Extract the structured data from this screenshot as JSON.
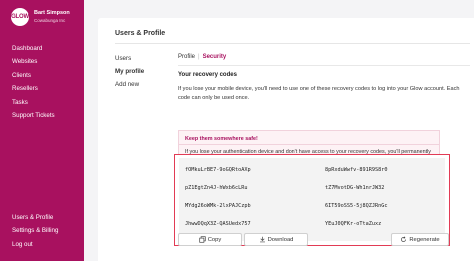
{
  "sidebar": {
    "logo_text": "GLOW",
    "user_name": "Bart Simpson",
    "user_subtitle": "Cowabunga Inc",
    "nav_items": [
      {
        "label": "Dashboard"
      },
      {
        "label": "Websites"
      },
      {
        "label": "Clients"
      },
      {
        "label": "Resellers"
      },
      {
        "label": "Tasks"
      },
      {
        "label": "Support Tickets"
      }
    ],
    "bottom_items": [
      {
        "label": "Users & Profile"
      },
      {
        "label": "Settings & Billing"
      },
      {
        "label": "Log out"
      }
    ]
  },
  "main": {
    "title": "Users & Profile",
    "submenu": [
      {
        "label": "Users"
      },
      {
        "label": "My profile"
      },
      {
        "label": "Add new"
      }
    ],
    "tabs": [
      {
        "label": "Profile"
      },
      {
        "label": "Security"
      }
    ],
    "tab_separator": "|",
    "section_heading": "Your recovery codes",
    "intro_text": "If you lose your mobile device, you'll need to use one of these recovery codes to log into your Glow account. Each code can only be used once.",
    "warning": {
      "heading": "Keep them somewhere safe!",
      "text": "If you lose your authentication device and don't have access to your recovery codes, you'll permanently lose access to your Glow account!"
    },
    "codes": [
      "fOMkuLrBE7-9oGQRtoAXp",
      "8pRxduWwfv-891R9S8r0",
      "pZ1EgtZn4J-hWxb6cLRu",
      "tZ7MvotDG-Wh1nrJW32",
      "MYdg26oWMk-2lxPAJCzpb",
      "6IT59oSS5-5j8QZJRnGc",
      "JhwwDQqX3Z-QASUedx757",
      "YEuJ0QFKr-oTtaZuxz"
    ],
    "actions": {
      "copy_label": "Copy",
      "download_label": "Download",
      "regenerate_label": "Regenerate"
    }
  },
  "colors": {
    "brand": "#a8115f",
    "highlight_border": "#e23b55"
  },
  "icons": {
    "copy": "copy-icon",
    "download": "download-icon",
    "regenerate": "refresh-icon"
  }
}
